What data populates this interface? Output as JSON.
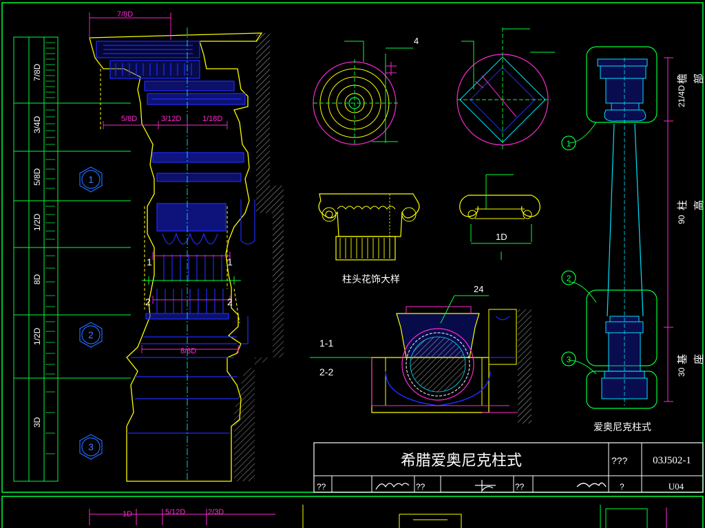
{
  "drawing": {
    "colors": {
      "background": "#000000",
      "frame": "#00ff3c",
      "outline": "#ffff00",
      "detail": "#1f2bff",
      "dimension": "#ff2ad4",
      "axis": "#00e5ff",
      "text": "#ffffff",
      "hatch": "#9a9a9a"
    },
    "left_elevation": {
      "side_labels": [
        "7/8D",
        "3/4D",
        "5/8D",
        "1/2D",
        "8D",
        "1/2D",
        "3D"
      ],
      "circle_markers": [
        "1",
        "2",
        "3"
      ],
      "top_dim": "7/8D",
      "dims_row": [
        "5/8D",
        "3/12D",
        "1/18D"
      ],
      "section_marks": [
        "1",
        "1",
        "2",
        "2"
      ],
      "base_dim": "8/6D"
    },
    "plan_views": {
      "dim_label": "4"
    },
    "capital_detail": {
      "dim_label": "1D",
      "caption": "柱头花饰大样"
    },
    "section_view": {
      "dim_label": "24",
      "labels": [
        "1-1",
        "2-2"
      ]
    },
    "right_elevation": {
      "side_labels": [
        "21/4D",
        "90",
        "30"
      ],
      "side_words": [
        "檐",
        "部",
        "柱",
        "高",
        "基",
        "座"
      ],
      "circle_markers": [
        "1",
        "2",
        "3"
      ],
      "caption": "爱奥尼克柱式"
    },
    "title_block": {
      "title": "希腊爱奥尼克柱式",
      "col_mark": "???",
      "atlas_no": "03J502-1",
      "row_fields": [
        "??",
        "??",
        "??",
        "?"
      ],
      "page_no": "U04"
    },
    "bottom_sheet": {
      "dims": [
        "1D",
        "5/12D",
        "2/3D"
      ]
    }
  }
}
